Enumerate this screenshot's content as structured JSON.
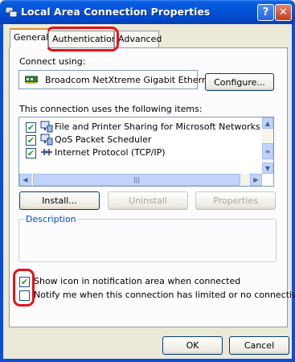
{
  "window": {
    "title": "Local Area Connection Properties",
    "help": "?",
    "close": "✕"
  },
  "tabs": [
    {
      "label": "General",
      "active": true
    },
    {
      "label": "Authentication",
      "active": false
    },
    {
      "label": "Advanced",
      "active": false
    }
  ],
  "connect_using": {
    "label": "Connect using:",
    "adapter": "Broadcom NetXtreme Gigabit Etherne",
    "configure_button": "Configure..."
  },
  "items": {
    "label": "This connection uses the following items:",
    "list": [
      {
        "label": "File and Printer Sharing for Microsoft Networks",
        "checked": true,
        "icon": "network-share-icon"
      },
      {
        "label": "QoS Packet Scheduler",
        "checked": true,
        "icon": "network-share-icon"
      },
      {
        "label": "Internet Protocol (TCP/IP)",
        "checked": true,
        "icon": "protocol-icon"
      }
    ]
  },
  "buttons": {
    "install": "Install...",
    "uninstall": "Uninstall",
    "properties": "Properties",
    "ok": "OK",
    "cancel": "Cancel"
  },
  "description": {
    "label": "Description"
  },
  "options": [
    {
      "label": "Show icon in notification area when connected",
      "checked": true
    },
    {
      "label": "Notify me when this connection has limited or no connectivity",
      "checked": false
    }
  ],
  "colors": {
    "title_bar": "#0553d8",
    "accent_tab": "#e68b2c",
    "highlight": "#e8101a",
    "group_label": "#0046d5"
  }
}
